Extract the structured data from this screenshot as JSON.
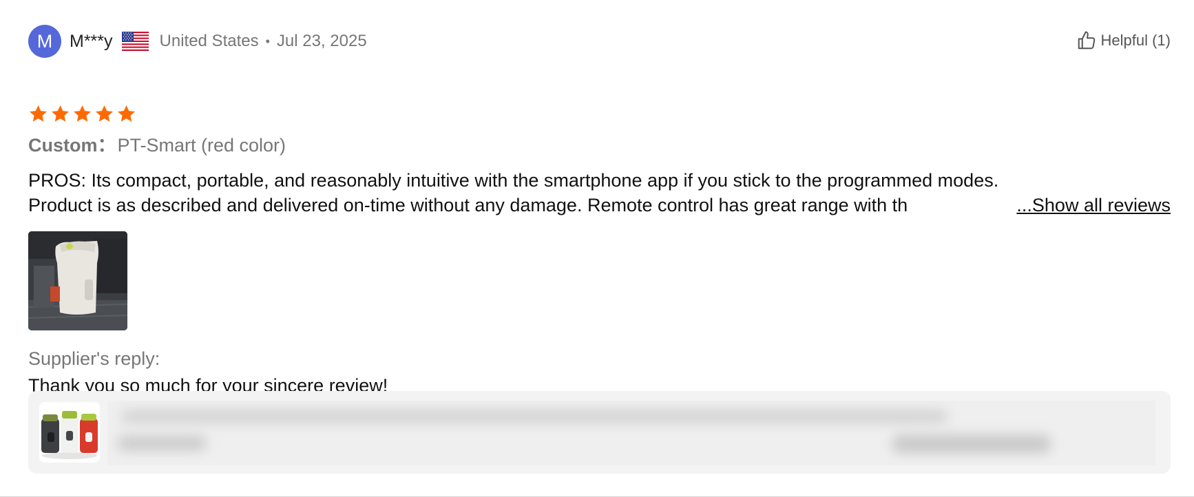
{
  "reviewer": {
    "avatar_initial": "M",
    "name": "M***y",
    "flag_icon": "us-flag-icon",
    "country": "United States",
    "separator": "•",
    "date": "Jul 23, 2025"
  },
  "helpful": {
    "label": "Helpful (1)",
    "icon": "thumbs-up-icon"
  },
  "rating": {
    "stars": 5,
    "max": 5,
    "color": "#ff6a00"
  },
  "custom": {
    "label": "Custom：",
    "value": "PT-Smart (red color)"
  },
  "review": {
    "line1": "PROS: Its compact, portable, and reasonably intuitive with the smartphone app if you stick to the programmed modes.",
    "line2": "Product is as described and delivered on-time without any damage. Remote control has great range with th",
    "show_all": "...Show all reviews"
  },
  "supplier": {
    "label": "Supplier's reply:",
    "reply": "Thank you so much for your sincere review!"
  },
  "colors": {
    "avatar": "#5568d9",
    "star": "#ff6a00",
    "muted_text": "#767676",
    "card_bg": "#f3f3f3"
  }
}
